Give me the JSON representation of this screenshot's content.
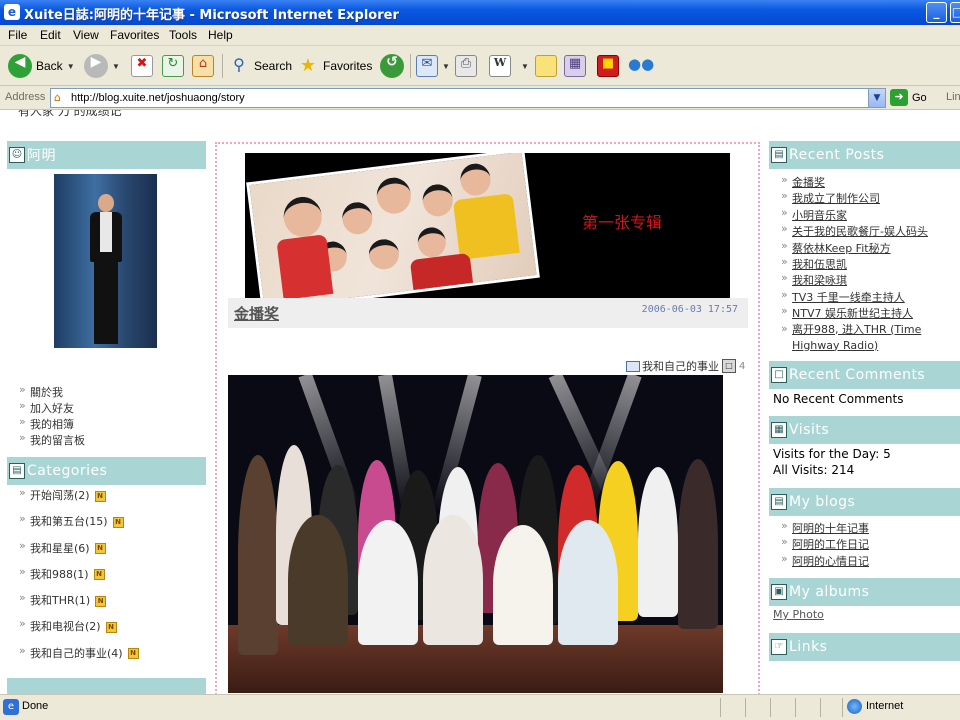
{
  "window": {
    "title": "Xuite日誌:阿明的十年记事 - Microsoft Internet Explorer",
    "minimize": "_",
    "maximize": "□"
  },
  "menu": [
    "File",
    "Edit",
    "View",
    "Favorites",
    "Tools",
    "Help"
  ],
  "toolbar": {
    "back": "Back",
    "search": "Search",
    "favorites": "Favorites"
  },
  "address": {
    "label": "Address",
    "url": "http://blog.xuite.net/joshuaong/story",
    "go": "Go",
    "links": "Lin"
  },
  "left_sidebar": {
    "cut_text": "有人家 刀 的成绩记",
    "profile_title": "阿明",
    "profile_links": [
      "關於我",
      "加入好友",
      "我的相簿",
      "我的留言板"
    ],
    "categories_title": "Categories",
    "categories": [
      "开始闯荡(2)",
      "我和第五台(15)",
      "我和星星(6)",
      "我和988(1)",
      "我和THR(1)",
      "我和电视台(2)",
      "我和自己的事业(4)"
    ],
    "new_badge": "N"
  },
  "main": {
    "banner_text": "第一张专辑",
    "post_title": "金播奖",
    "post_date": "2006-06-03 17:57",
    "post_category": "我和自己的事业",
    "post_count": "4"
  },
  "right_sidebar": {
    "recent_posts_title": "Recent Posts",
    "recent_posts": [
      "金播奖",
      "我成立了制作公司",
      "小明音乐家",
      "关于我的民歌餐厅-娱人码头",
      "蔡依林Keep Fit秘方",
      "我和伍思凯",
      "我和梁咏琪",
      "TV3 千里一线牵主持人",
      "NTV7 娱乐新世纪主持人",
      "离开988, 进入THR (Time Highway Radio)"
    ],
    "recent_comments_title": "Recent Comments",
    "no_comments": "No Recent Comments",
    "visits_title": "Visits",
    "visits_day": "Visits for the Day: 5",
    "visits_all": "All Visits: 214",
    "blogs_title": "My blogs",
    "blogs": [
      "阿明的十年记事",
      "阿明的工作日记",
      "阿明的心情日记"
    ],
    "albums_title": "My albums",
    "album_link": "My Photo",
    "links_title": "Links"
  },
  "status": {
    "text": "Done",
    "zone": "Internet"
  }
}
